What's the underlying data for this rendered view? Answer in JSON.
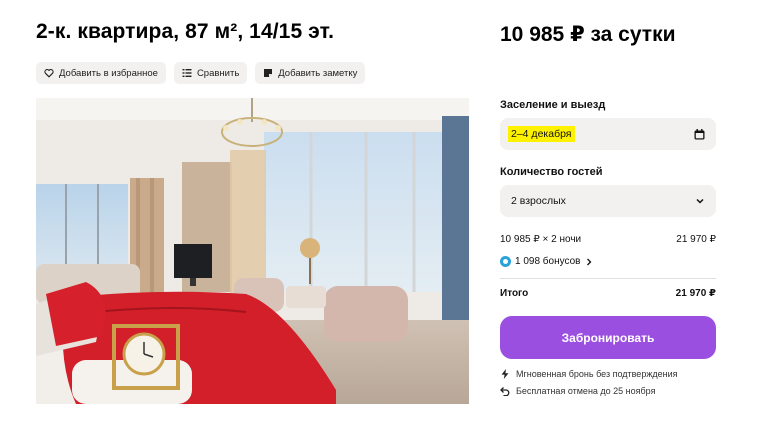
{
  "listing": {
    "title": "2-к. квартира, 87 м², 14/15 эт.",
    "actions": {
      "favorite": "Добавить в избранное",
      "compare": "Сравнить",
      "note": "Добавить заметку"
    },
    "photo_icon": "bedroom-photo"
  },
  "booking": {
    "price": "10 985 ₽ за сутки",
    "checkin_label": "Заселение и выезд",
    "dates": "2–4 декабря",
    "guests_label": "Количество гостей",
    "guests": "2 взрослых",
    "calc_label": "10 985 ₽ × 2 ночи",
    "calc_value": "21 970 ₽",
    "bonus": "1 098 бонусов",
    "total_label": "Итого",
    "total_value": "21 970 ₽",
    "book_button": "Забронировать",
    "instant": "Мгновенная бронь без подтверждения",
    "cancel": "Бесплатная отмена до 25 ноября"
  },
  "colors": {
    "accent": "#9b4fe0",
    "highlight": "#fff200",
    "field_bg": "#f2f1f0",
    "bonus": "#2aa1d8"
  }
}
